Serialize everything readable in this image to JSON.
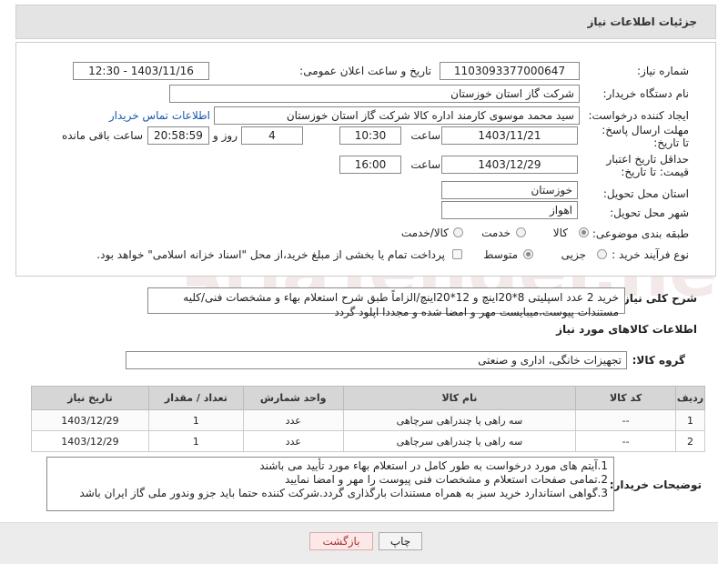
{
  "header": {
    "title": "جزئیات اطلاعات نیاز"
  },
  "form": {
    "need_number": {
      "label": "شماره نیاز:",
      "value": "1103093377000647"
    },
    "announce": {
      "label": "تاریخ و ساعت اعلان عمومی:",
      "value": "1403/11/16 - 12:30"
    },
    "buyer_org": {
      "label": "نام دستگاه خریدار:",
      "value": "شرکت گاز استان خوزستان"
    },
    "requester": {
      "label": "ایجاد کننده درخواست:",
      "value": "سید محمد موسوی کارمند اداره کالا شرکت گاز استان خوزستان",
      "link": "اطلاعات تماس خریدار"
    },
    "deadline": {
      "label": "مهلت ارسال پاسخ: تا تاریخ:",
      "date": "1403/11/21",
      "time_label": "ساعت",
      "time": "10:30",
      "days": "4",
      "days_label": "روز و",
      "remaining": "20:58:59",
      "remaining_label": "ساعت باقی مانده"
    },
    "price_validity": {
      "label": "حداقل تاریخ اعتبار قیمت: تا تاریخ:",
      "date": "1403/12/29",
      "time_label": "ساعت",
      "time": "16:00"
    },
    "province": {
      "label": "استان محل تحویل:",
      "value": "خوزستان"
    },
    "city": {
      "label": "شهر محل تحویل:",
      "value": "اهواز"
    },
    "category": {
      "label": "طبقه بندی موضوعی:",
      "options": [
        "کالا",
        "خدمت",
        "کالا/خدمت"
      ],
      "selected": "کالا"
    },
    "process": {
      "label": "نوع فرآیند خرید :",
      "options": [
        "جزیی",
        "متوسط"
      ],
      "selected": "متوسط",
      "payment_note": "پرداخت تمام یا بخشی از مبلغ خرید،از محل \"اسناد خزانه اسلامی\" خواهد بود."
    }
  },
  "general_desc": {
    "label": "شرح کلی نیاز:",
    "value": "خرید 2 عدد اسپلیتی 8*20اینچ و 12*20اینچ/الزاماً طبق شرح استعلام بهاء و مشخصات فنی/کلیه مستندات پیوست،میبایست مهر و امضا شده و مجددا اپلود گردد"
  },
  "items_section": {
    "title": "اطلاعات کالاهای مورد نیاز",
    "group_label": "گروه کالا:",
    "group_value": "تجهیزات خانگی، اداری و صنعتی"
  },
  "table": {
    "headers": [
      "ردیف",
      "کد کالا",
      "نام کالا",
      "واحد شمارش",
      "تعداد / مقدار",
      "تاریخ نیاز"
    ],
    "rows": [
      [
        "1",
        "--",
        "سه راهی یا چندراهی سرچاهی",
        "عدد",
        "1",
        "1403/12/29"
      ],
      [
        "2",
        "--",
        "سه راهی یا چندراهی سرچاهی",
        "عدد",
        "1",
        "1403/12/29"
      ]
    ]
  },
  "notes": {
    "label": "توضیحات خریدار:",
    "lines": [
      "1.آیتم های مورد درخواست به طور کامل در استعلام بهاء مورد تأیید می باشند",
      "2.تمامی صفحات استعلام و مشخصات فنی پیوست را مهر و امضا نمایید",
      "3.گواهی استاندارد خرید سبز به همراه مستندات بارگذاری گردد.شرکت کننده حتما باید جزو وندور ملی گاز ایران باشد"
    ]
  },
  "buttons": {
    "print": "چاپ",
    "back": "بازگشت"
  },
  "watermark": {
    "text": "AriaTender.net"
  },
  "colors": {
    "link": "#1a56b0",
    "header_bg": "#e4e4e4",
    "back_button_bg": "#fde8e8"
  }
}
